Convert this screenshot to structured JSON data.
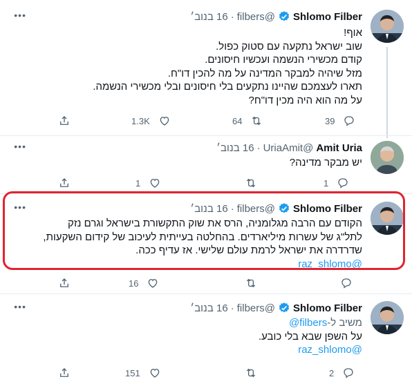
{
  "tweets": [
    {
      "name": "Shlomo Filber",
      "handle": "@filbers",
      "time": "16 בנוב׳",
      "lines": [
        "אוף!",
        "שוב ישראל נתקעה עם סטוק כפול.",
        "קודם מכשירי הנשמה ועכשיו חיסונים.",
        "מזל שיהיה למבקר המדינה על מה להכין דו\"ח.",
        "תארו לעצמכם שהיינו נתקעים בלי חיסונים ובלי מכשירי הנשמה.",
        "על מה הוא היה מכין דו\"ח?"
      ],
      "replies": "39",
      "retweets": "64",
      "likes": "1.3K"
    },
    {
      "name": "Amit Uria",
      "handle": "@UriaAmit",
      "time": "16 בנוב׳",
      "lines": [
        "יש מבקר מדינה?"
      ],
      "replies": "1",
      "retweets": "",
      "likes": "1"
    },
    {
      "name": "Shlomo Filber",
      "handle": "@filbers",
      "time": "16 בנוב׳",
      "lines": [
        "הקודם עם הרבה מגלומניה, הרס את שוק התקשורת בישראל וגרם נזק",
        "לתל\"ג של עשרות מיליארדים. בהחלטה בעייתית לעיכוב של קידום השקעות,",
        "שדרדרה את ישראל לרמת עולם שלישי. אז עדיף ככה."
      ],
      "mention": "@raz_shlomo",
      "replies": "",
      "retweets": "",
      "likes": "16"
    },
    {
      "name": "Shlomo Filber",
      "handle": "@filbers",
      "time": "16 בנוב׳",
      "reply_to_prefix": "משיב ל-",
      "reply_to_handle": "@filbers",
      "lines": [
        "על השפן שבא בלי כובע."
      ],
      "mention": "@raz_shlomo",
      "replies": "2",
      "retweets": "",
      "likes": "151"
    }
  ],
  "dot": "·",
  "more": "•••",
  "colors": {
    "accent": "#1d9bf0",
    "highlight": "#e0242f",
    "muted": "#536471"
  },
  "icons": [
    "reply-icon",
    "retweet-icon",
    "like-icon",
    "share-icon",
    "verified-icon",
    "more-icon"
  ]
}
